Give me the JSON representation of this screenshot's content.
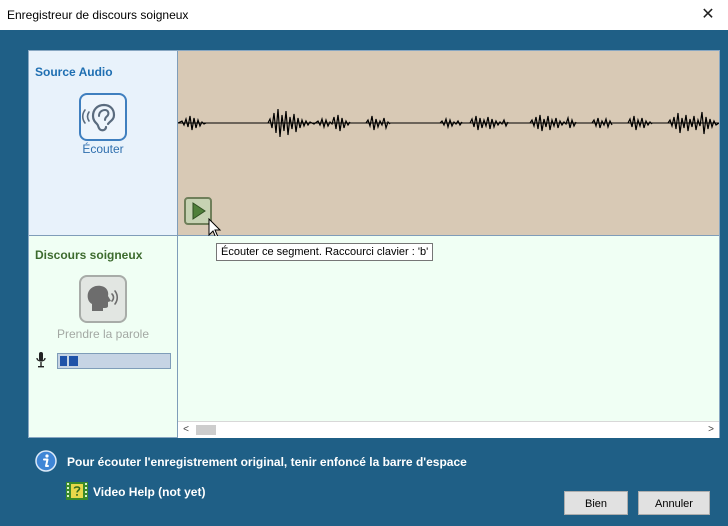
{
  "window": {
    "title": "Enregistreur de discours soigneux",
    "close_glyph": "✕"
  },
  "source": {
    "title": "Source Audio",
    "listen_label": "Écouter",
    "listen_icon": "ear-icon"
  },
  "speech": {
    "title": "Discours soigneux",
    "speak_label": "Prendre la parole",
    "speak_icon": "speaking-head-icon",
    "mic_icon": "microphone-icon",
    "level": 0.16
  },
  "waveform": {
    "play_icon": "play-icon"
  },
  "tooltip": {
    "text": "Écouter ce segment. Raccourci clavier : 'b'"
  },
  "scrollbar": {
    "left_arrow": "<",
    "right_arrow": ">"
  },
  "info": {
    "text": "Pour écouter l'enregistrement original, tenir enfoncé la barre d'espace",
    "icon": "info-icon"
  },
  "help": {
    "text": "Video Help (not yet)",
    "icon": "video-help-icon"
  },
  "buttons": {
    "ok": "Bien",
    "cancel": "Annuler"
  },
  "colors": {
    "dialog_bg": "#1f5f86",
    "wave_bg": "#d8c9b5",
    "speech_bg": "#f0fff4",
    "source_bg": "#e8f2fb"
  }
}
